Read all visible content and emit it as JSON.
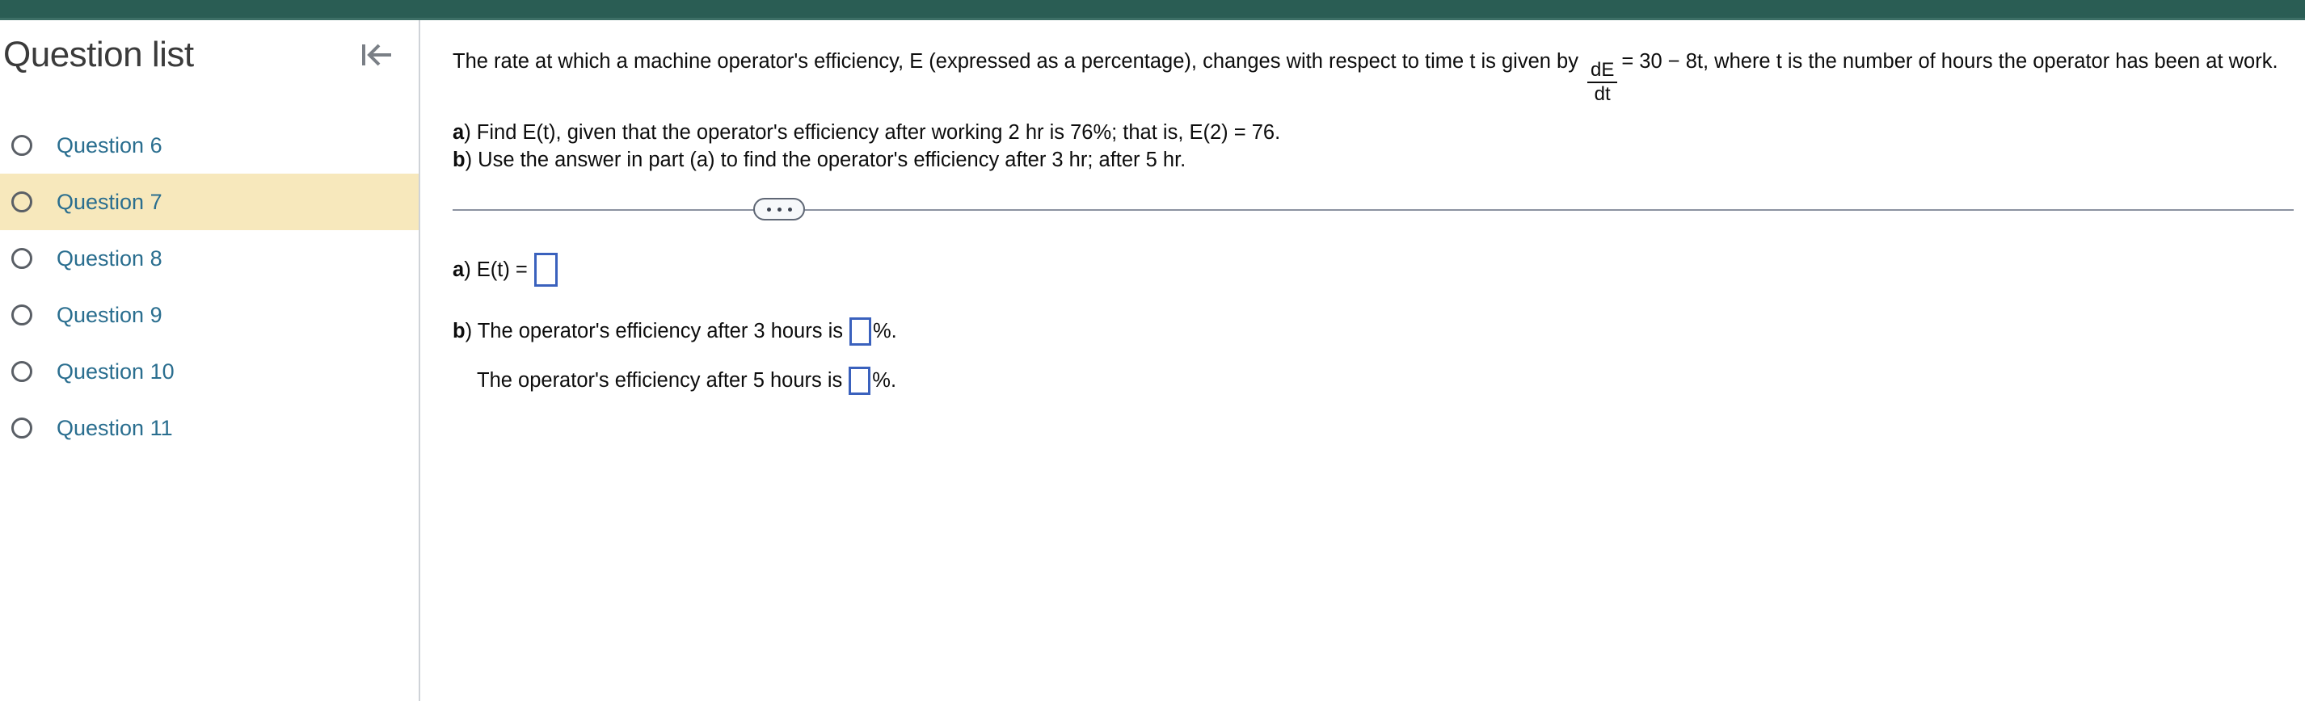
{
  "top_bar": {
    "color": "#2a5d54"
  },
  "sidebar": {
    "title": "Question list",
    "collapse_icon": "collapse-left-icon",
    "selected_index": 1,
    "items": [
      {
        "label": "Question 6",
        "selected": false
      },
      {
        "label": "Question 7",
        "selected": true
      },
      {
        "label": "Question 8",
        "selected": false
      },
      {
        "label": "Question 9",
        "selected": false
      },
      {
        "label": "Question 10",
        "selected": false
      },
      {
        "label": "Question 11",
        "selected": false
      }
    ],
    "highlight_color": "#f7e8bc",
    "link_color": "#2a6e8f"
  },
  "problem": {
    "text_before_fraction": "The rate at which a machine operator's efficiency, E (expressed as a percentage), changes with respect to time t is given by",
    "fraction_numerator": "dE",
    "fraction_denominator": "dt",
    "text_after_fraction": "= 30 − 8t, where t is the number of hours the operator has been at work.",
    "part_a_letter": "a",
    "part_a_text": ") Find E(t), given that the operator's efficiency after working 2 hr is 76%; that is, E(2) = 76.",
    "part_b_letter": "b",
    "part_b_text": ") Use the answer in part (a) to find the operator's efficiency after 3 hr; after 5 hr."
  },
  "divider": {
    "menu_label": "•••",
    "line_color": "#8b92a0"
  },
  "answers": {
    "a_letter": "a",
    "a_prefix": ") E(t) =",
    "a_value": "",
    "b_letter": "b",
    "b_prefix": ") The operator's efficiency after 3 hours is",
    "b_value": "",
    "b_suffix": "%.",
    "c_prefix": "The operator's efficiency after 5 hours is",
    "c_value": "",
    "c_suffix": "%.",
    "box_border_color": "#3a61bd"
  }
}
